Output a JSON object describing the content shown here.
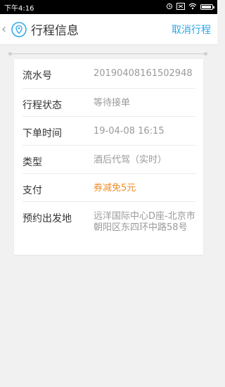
{
  "status": {
    "time": "下午4:16",
    "icons": [
      "alarm-icon",
      "signal-icon",
      "battery-icon"
    ],
    "battery_level": 0.9
  },
  "header": {
    "title": "行程信息",
    "cancel_label": "取消行程",
    "back_icon": "chevron-left-icon",
    "pin_icon": "location-pin-icon"
  },
  "details": [
    {
      "label": "流水号",
      "value": "20190408161502948"
    },
    {
      "label": "行程状态",
      "value": "等待接单"
    },
    {
      "label": "下单时间",
      "value": "19-04-08 16:15"
    },
    {
      "label": "类型",
      "value": "酒后代驾（实时）"
    },
    {
      "label": "支付",
      "value": "券减免5元"
    },
    {
      "label": "预约出发地",
      "value": "远洋国际中心D座-北京市朝阳区东四环中路58号"
    }
  ],
  "colors": {
    "accent_blue": "#2aa6e8",
    "orange": "#f08d24",
    "text": "#333333",
    "muted": "#9a9a9a"
  }
}
